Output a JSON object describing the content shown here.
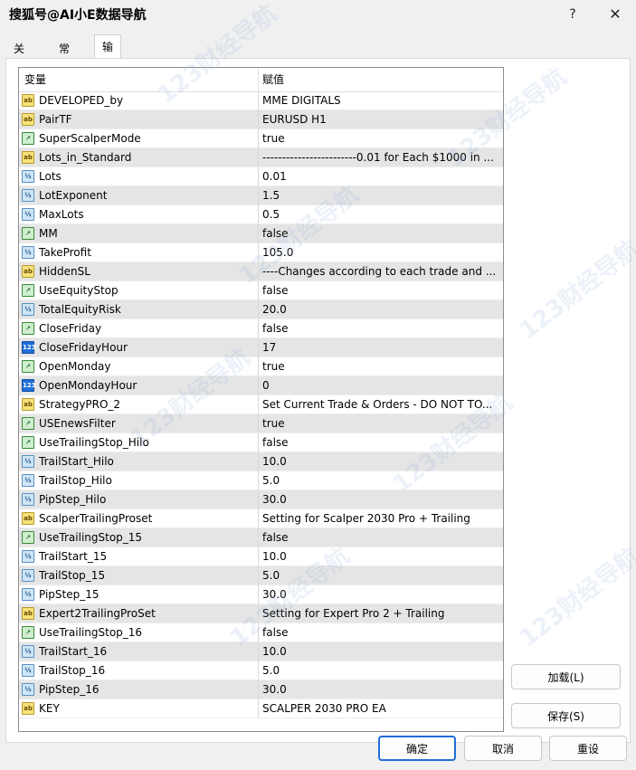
{
  "window": {
    "title": "搜狐号@AI小E数据导航",
    "help_label": "?",
    "close_label": "✕"
  },
  "tabs": [
    {
      "label": "关于"
    },
    {
      "label": "常用"
    },
    {
      "label": "输入参数"
    }
  ],
  "grid": {
    "header_variable": "变量",
    "header_value": "赋值",
    "rows": [
      {
        "icon": "string-type-icon",
        "name": "DEVELOPED_by",
        "value": "MME DIGITALS"
      },
      {
        "icon": "string-type-icon",
        "name": "PairTF",
        "value": "EURUSD H1"
      },
      {
        "icon": "bool-type-icon",
        "name": "SuperScalperMode",
        "value": "true"
      },
      {
        "icon": "string-type-icon",
        "name": "Lots_in_Standard",
        "value": "------------------------0.01 for Each $1000 in ..."
      },
      {
        "icon": "double-type-icon",
        "name": "Lots",
        "value": "0.01"
      },
      {
        "icon": "double-type-icon",
        "name": "LotExponent",
        "value": "1.5"
      },
      {
        "icon": "double-type-icon",
        "name": "MaxLots",
        "value": "0.5"
      },
      {
        "icon": "bool-type-icon",
        "name": "MM",
        "value": "false"
      },
      {
        "icon": "double-type-icon",
        "name": "TakeProfit",
        "value": "105.0"
      },
      {
        "icon": "string-type-icon",
        "name": "HiddenSL",
        "value": "----Changes according to each trade and ..."
      },
      {
        "icon": "bool-type-icon",
        "name": "UseEquityStop",
        "value": "false"
      },
      {
        "icon": "double-type-icon",
        "name": "TotalEquityRisk",
        "value": "20.0"
      },
      {
        "icon": "bool-type-icon",
        "name": "CloseFriday",
        "value": "false"
      },
      {
        "icon": "int-type-icon",
        "name": "CloseFridayHour",
        "value": "17"
      },
      {
        "icon": "bool-type-icon",
        "name": "OpenMonday",
        "value": "true"
      },
      {
        "icon": "int-type-icon",
        "name": "OpenMondayHour",
        "value": "0"
      },
      {
        "icon": "string-type-icon",
        "name": "StrategyPRO_2",
        "value": "Set Current Trade & Orders - DO NOT TO..."
      },
      {
        "icon": "bool-type-icon",
        "name": "USEnewsFilter",
        "value": "true"
      },
      {
        "icon": "bool-type-icon",
        "name": "UseTrailingStop_Hilo",
        "value": "false"
      },
      {
        "icon": "double-type-icon",
        "name": "TrailStart_Hilo",
        "value": "10.0"
      },
      {
        "icon": "double-type-icon",
        "name": "TrailStop_Hilo",
        "value": "5.0"
      },
      {
        "icon": "double-type-icon",
        "name": "PipStep_Hilo",
        "value": "30.0"
      },
      {
        "icon": "string-type-icon",
        "name": "ScalperTrailingProset",
        "value": "Setting for Scalper 2030 Pro + Trailing"
      },
      {
        "icon": "bool-type-icon",
        "name": "UseTrailingStop_15",
        "value": "false"
      },
      {
        "icon": "double-type-icon",
        "name": "TrailStart_15",
        "value": "10.0"
      },
      {
        "icon": "double-type-icon",
        "name": "TrailStop_15",
        "value": "5.0"
      },
      {
        "icon": "double-type-icon",
        "name": "PipStep_15",
        "value": "30.0"
      },
      {
        "icon": "string-type-icon",
        "name": "Expert2TrailingProSet",
        "value": "Setting for Expert Pro 2 + Trailing"
      },
      {
        "icon": "bool-type-icon",
        "name": "UseTrailingStop_16",
        "value": "false"
      },
      {
        "icon": "double-type-icon",
        "name": "TrailStart_16",
        "value": "10.0"
      },
      {
        "icon": "double-type-icon",
        "name": "TrailStop_16",
        "value": "5.0"
      },
      {
        "icon": "double-type-icon",
        "name": "PipStep_16",
        "value": "30.0"
      },
      {
        "icon": "string-type-icon",
        "name": "KEY",
        "value": "SCALPER 2030 PRO EA"
      }
    ]
  },
  "buttons": {
    "load": "加载(L)",
    "save": "保存(S)",
    "ok": "确定",
    "cancel": "取消",
    "reset": "重设"
  },
  "icon_glyphs": {
    "string-type-icon": "ab",
    "double-type-icon": "½",
    "bool-type-icon": "↗",
    "int-type-icon": "123"
  },
  "watermark_text": "123财经导航"
}
